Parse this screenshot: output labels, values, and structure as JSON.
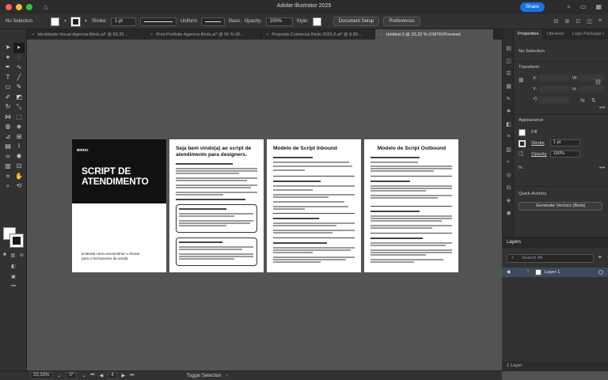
{
  "window": {
    "title": "Adobe Illustrator 2025",
    "share_label": "Share",
    "traffic": {
      "close": "#ff5f57",
      "min": "#febc2e",
      "max": "#28c840"
    }
  },
  "control_bar": {
    "selection": "No Selection",
    "stroke_label": "Stroke:",
    "stroke_weight": "1 pt",
    "stroke_profile": "Uniform",
    "brush": "Basic",
    "opacity_label": "Opacity:",
    "opacity_value": "100%",
    "style_label": "Style:",
    "document_setup": "Document Setup",
    "preferences": "Preferences"
  },
  "tabs": [
    {
      "label": "Identidade-Visual-Agencia-Birdo.ai* @ 83,33...",
      "active": false
    },
    {
      "label": "Post-Portfolio-Agencia-Birdo.ai* @ 50 % (R...",
      "active": false
    },
    {
      "label": "Proposta Comercial Birdo 2025-2.ai* @ 8,89...",
      "active": false
    },
    {
      "label": "Untitled-3 @ 33,33 % (CMYK/Preview)",
      "active": true
    }
  ],
  "artboards": {
    "cover": {
      "logo": "BIRDO",
      "title_line1": "SCRIPT DE",
      "title_line2": "ATENDIMENTO",
      "subtitle_line1": "Entenda como encaminhar o cliente",
      "subtitle_line2": "para o fechamento da venda."
    },
    "welcome": {
      "heading_line1": "Seja bem vindo(a) ao script de",
      "heading_line2": "atendimento para designers."
    },
    "inbound": {
      "heading": "Modelo de Script Inbound"
    },
    "outbound": {
      "heading": "Modelo de Script Outbound"
    }
  },
  "properties": {
    "tabs": [
      "Properties",
      "Libraries",
      "Logo Package I"
    ],
    "selection": "No Selection",
    "transform_title": "Transform",
    "x_label": "X:",
    "y_label": "Y:",
    "w_label": "W:",
    "h_label": "H:",
    "appearance_title": "Appearance",
    "fill_label": "Fill",
    "stroke_label": "Stroke",
    "stroke_value": "1 pt",
    "opacity_label": "Opacity",
    "opacity_value": "100%",
    "fx_label": "fx.",
    "quick_actions_title": "Quick Actions",
    "generate_vectors": "Generate Vectors (Beta)"
  },
  "layers": {
    "title": "Layers",
    "search_placeholder": "Search All",
    "layer_name": "Layer 1",
    "footer": "1 Layer"
  },
  "status_bar": {
    "zoom": "33,33%",
    "rotation": "0°",
    "artboard_number": "4",
    "tool": "Toggle Selection"
  }
}
